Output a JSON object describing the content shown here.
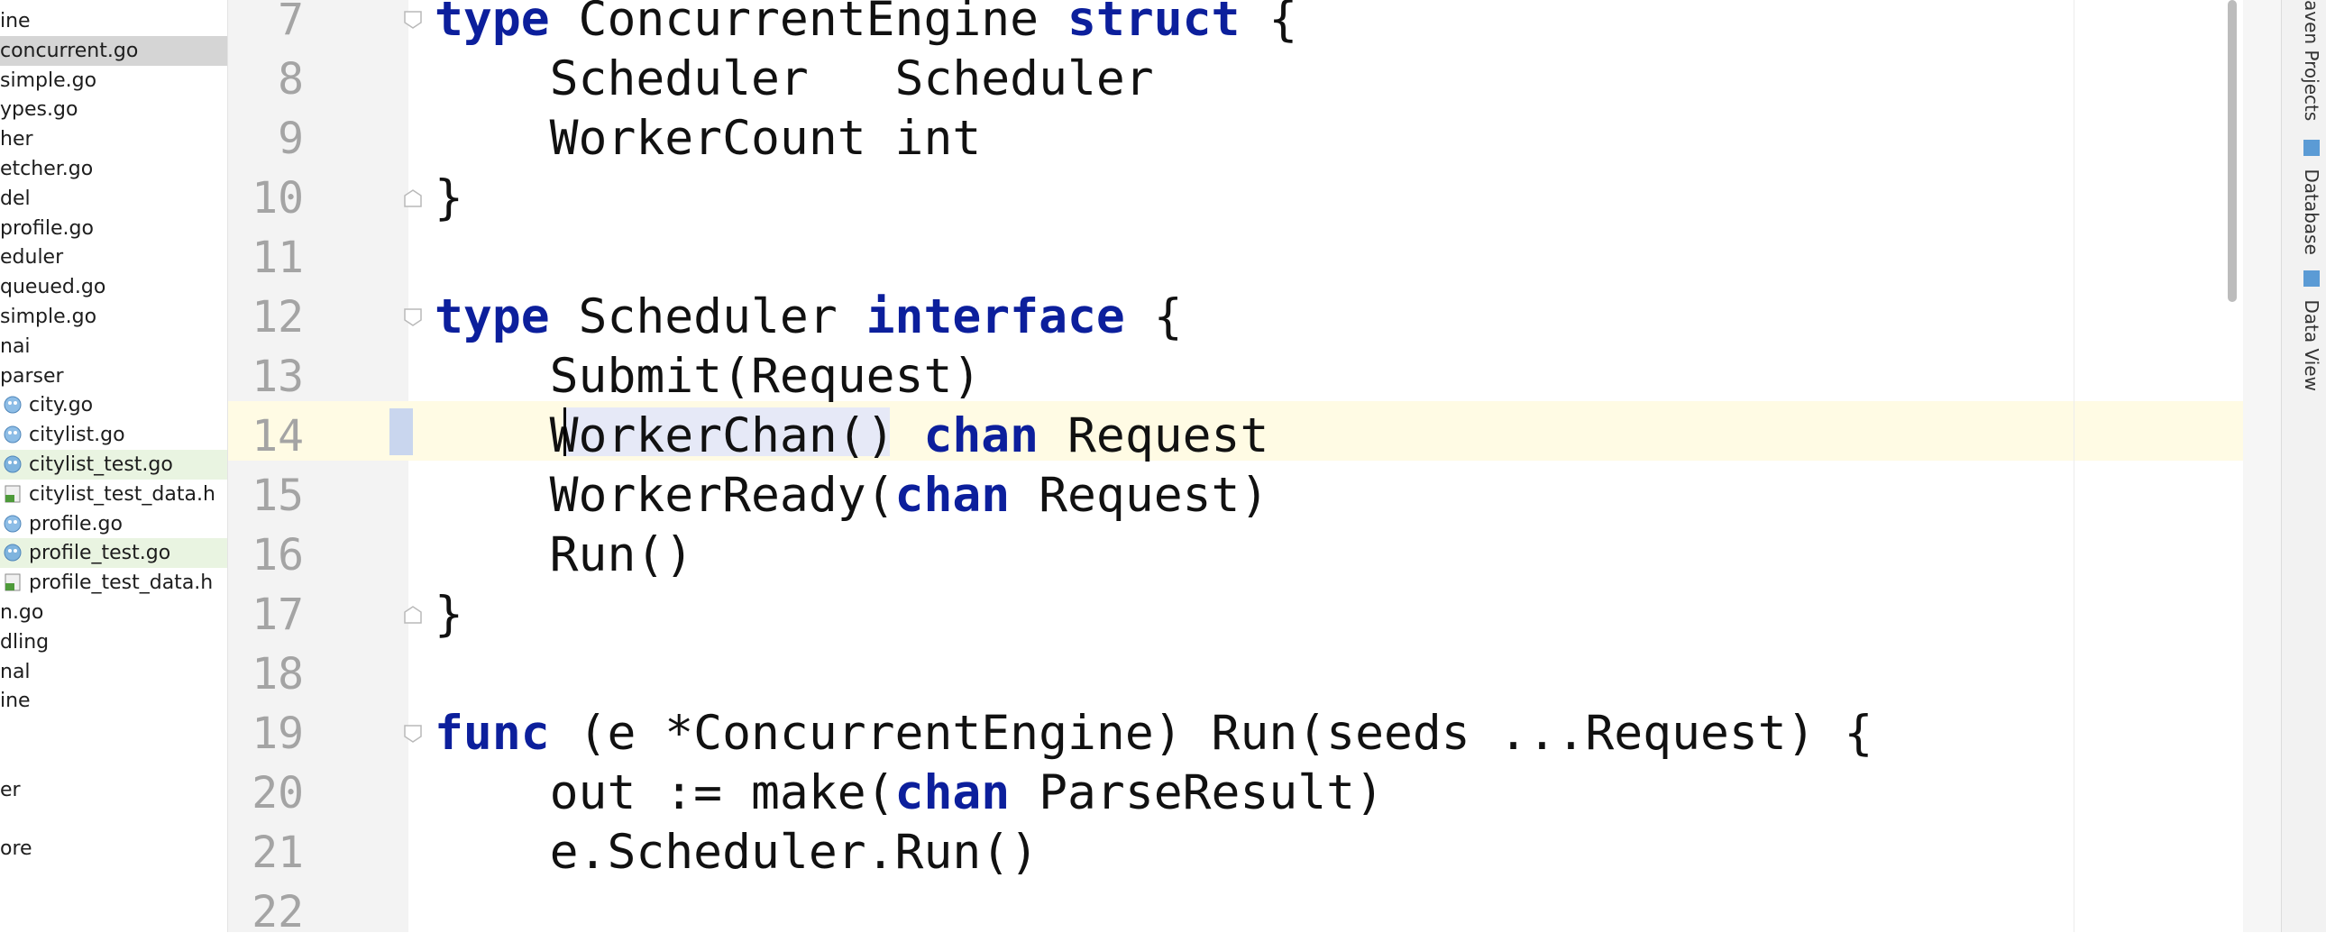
{
  "project_tree": {
    "items": [
      {
        "label": "ine",
        "indent": 0,
        "icon": "none"
      },
      {
        "label": "concurrent.go",
        "indent": 0,
        "icon": "none",
        "selected": true
      },
      {
        "label": "simple.go",
        "indent": 0,
        "icon": "none"
      },
      {
        "label": "ypes.go",
        "indent": 0,
        "icon": "none"
      },
      {
        "label": "her",
        "indent": 0,
        "icon": "none"
      },
      {
        "label": "etcher.go",
        "indent": 0,
        "icon": "none"
      },
      {
        "label": "del",
        "indent": 0,
        "icon": "none"
      },
      {
        "label": "profile.go",
        "indent": 0,
        "icon": "none"
      },
      {
        "label": "eduler",
        "indent": 0,
        "icon": "none"
      },
      {
        "label": "queued.go",
        "indent": 0,
        "icon": "none"
      },
      {
        "label": "simple.go",
        "indent": 0,
        "icon": "none"
      },
      {
        "label": "nai",
        "indent": 0,
        "icon": "none"
      },
      {
        "label": "parser",
        "indent": 0,
        "icon": "none"
      },
      {
        "label": "city.go",
        "indent": 1,
        "icon": "go-file-icon"
      },
      {
        "label": "citylist.go",
        "indent": 1,
        "icon": "go-file-icon"
      },
      {
        "label": "citylist_test.go",
        "indent": 1,
        "icon": "go-test-file-icon",
        "test": true
      },
      {
        "label": "citylist_test_data.h",
        "indent": 1,
        "icon": "html-file-icon"
      },
      {
        "label": "profile.go",
        "indent": 1,
        "icon": "go-file-icon"
      },
      {
        "label": "profile_test.go",
        "indent": 1,
        "icon": "go-test-file-icon",
        "test": true
      },
      {
        "label": "profile_test_data.h",
        "indent": 1,
        "icon": "html-file-icon"
      },
      {
        "label": "n.go",
        "indent": 0,
        "icon": "none"
      },
      {
        "label": "dling",
        "indent": 0,
        "icon": "none"
      },
      {
        "label": "nal",
        "indent": 0,
        "icon": "none"
      },
      {
        "label": "ine",
        "indent": 0,
        "icon": "none"
      },
      {
        "label": "",
        "indent": 0,
        "icon": "none"
      },
      {
        "label": "",
        "indent": 0,
        "icon": "none"
      },
      {
        "label": "er",
        "indent": 0,
        "icon": "none"
      },
      {
        "label": "",
        "indent": 0,
        "icon": "none"
      },
      {
        "label": "ore",
        "indent": 0,
        "icon": "none"
      }
    ]
  },
  "editor": {
    "current_line": 14,
    "lines": [
      {
        "num": "7",
        "tokens": [
          [
            "kw",
            "type"
          ],
          [
            "t",
            " ConcurrentEngine "
          ],
          [
            "kw",
            "struct"
          ],
          [
            "t",
            " {"
          ]
        ]
      },
      {
        "num": "8",
        "tokens": [
          [
            "t",
            "    Scheduler   Scheduler"
          ]
        ]
      },
      {
        "num": "9",
        "tokens": [
          [
            "t",
            "    WorkerCount int"
          ]
        ]
      },
      {
        "num": "10",
        "tokens": [
          [
            "t",
            "}"
          ]
        ]
      },
      {
        "num": "11",
        "tokens": []
      },
      {
        "num": "12",
        "tokens": [
          [
            "kw",
            "type"
          ],
          [
            "t",
            " Scheduler "
          ],
          [
            "kw",
            "interface"
          ],
          [
            "t",
            " {"
          ]
        ]
      },
      {
        "num": "13",
        "tokens": [
          [
            "t",
            "    Submit(Request)"
          ]
        ]
      },
      {
        "num": "14",
        "tokens": [
          [
            "t",
            "    WorkerChan() "
          ],
          [
            "kw",
            "chan"
          ],
          [
            "t",
            " Request"
          ]
        ]
      },
      {
        "num": "15",
        "tokens": [
          [
            "t",
            "    WorkerReady("
          ],
          [
            "kw",
            "chan"
          ],
          [
            "t",
            " Request)"
          ]
        ]
      },
      {
        "num": "16",
        "tokens": [
          [
            "t",
            "    Run()"
          ]
        ]
      },
      {
        "num": "17",
        "tokens": [
          [
            "t",
            "}"
          ]
        ]
      },
      {
        "num": "18",
        "tokens": []
      },
      {
        "num": "19",
        "tokens": [
          [
            "kw",
            "func"
          ],
          [
            "t",
            " (e *ConcurrentEngine) Run(seeds ...Request) {"
          ]
        ]
      },
      {
        "num": "20",
        "tokens": [
          [
            "t",
            "    out := make("
          ],
          [
            "kw",
            "chan"
          ],
          [
            "t",
            " ParseResult)"
          ]
        ]
      },
      {
        "num": "21",
        "tokens": [
          [
            "t",
            "    e.Scheduler.Run()"
          ]
        ]
      },
      {
        "num": "22",
        "tokens": []
      }
    ]
  },
  "right_toolbar": {
    "items": [
      {
        "label": "aven Projects",
        "icon": "maven-icon"
      },
      {
        "label": "Database",
        "icon": "database-icon"
      },
      {
        "label": "Data View",
        "icon": "data-view-icon"
      }
    ]
  },
  "colors": {
    "keyword": "#0c1f9c",
    "current_line": "#fffbe4",
    "selected_file": "#d5d5d5",
    "test_file": "#e9f4e1"
  }
}
